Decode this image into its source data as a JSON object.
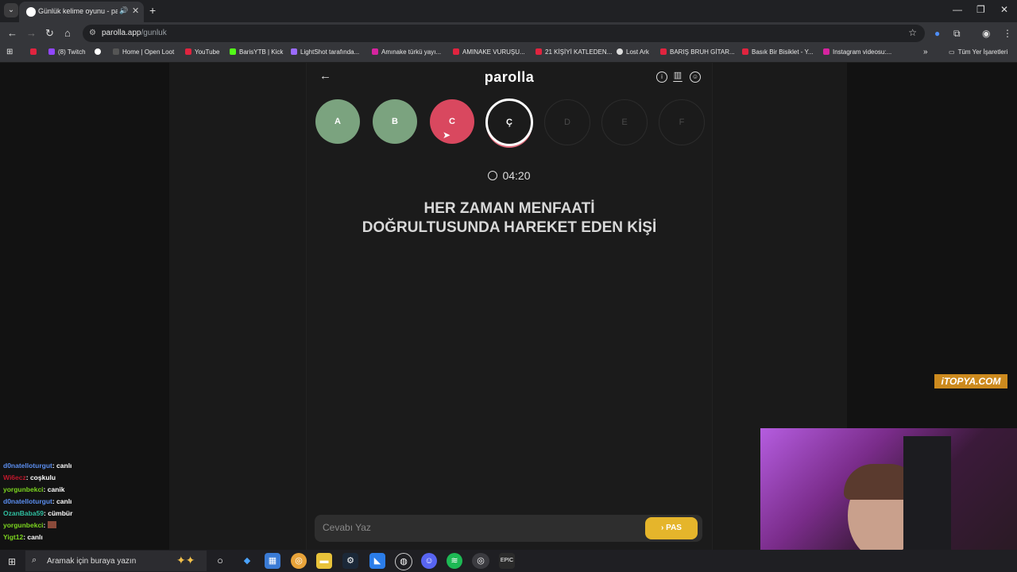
{
  "browser": {
    "tab_title": "Günlük kelime oyunu - parolla",
    "tab_audio_icon": "speaker-icon",
    "url_host": "parolla.app",
    "url_path": "/gunluk",
    "bookmarks": [
      {
        "label": "",
        "color": "#e0243f"
      },
      {
        "label": "(8) Twitch",
        "color": "#9146ff"
      },
      {
        "label": "",
        "color": "#ffffff"
      },
      {
        "label": "Home | Open Loot",
        "color": "#555555"
      },
      {
        "label": "YouTube",
        "color": "#e0243f"
      },
      {
        "label": "BarisYTB | Kick",
        "color": "#53fc18"
      },
      {
        "label": "LightShot tarafında...",
        "color": "#9b6bff"
      },
      {
        "label": "Amınake türkü yayı...",
        "color": "#d6249f"
      },
      {
        "label": "AMINAKE VURUŞU...",
        "color": "#e0243f"
      },
      {
        "label": "21 KİŞİYİ KATLEDEN...",
        "color": "#e0243f"
      },
      {
        "label": "Lost Ark",
        "color": "#dddddd"
      },
      {
        "label": "BARIŞ BRUH GİTAR...",
        "color": "#e0243f"
      },
      {
        "label": "Basık Bir Bisiklet - Y...",
        "color": "#e0243f"
      },
      {
        "label": "Instagram videosu:...",
        "color": "#d6249f"
      }
    ],
    "all_bookmarks_label": "Tüm Yer İşaretleri"
  },
  "app": {
    "logo": "parolla",
    "letters": [
      {
        "letter": "A",
        "state": "correct"
      },
      {
        "letter": "B",
        "state": "correct"
      },
      {
        "letter": "C",
        "state": "wrong"
      },
      {
        "letter": "Ç",
        "state": "active"
      },
      {
        "letter": "D",
        "state": "pending"
      },
      {
        "letter": "E",
        "state": "pending"
      },
      {
        "letter": "F",
        "state": "pending"
      }
    ],
    "timer": "04:20",
    "question_line1": "HER ZAMAN MENFAATİ",
    "question_line2": "DOĞRULTUSUNDA HAREKET EDEN KİŞİ",
    "answer_placeholder": "Cevabı Yaz",
    "pass_label": "PAS",
    "colors": {
      "correct": "#7ba37f",
      "wrong": "#d9485f",
      "pass": "#e5b52b"
    }
  },
  "overlay": {
    "watermark": "iTOPYA.COM"
  },
  "chat": [
    {
      "user": "d0natelloturgut",
      "msg": ": canlı",
      "color": "#5b8ef0"
    },
    {
      "user": "Wi6ecz",
      "msg": ": coşkulu",
      "color": "#c0182c"
    },
    {
      "user": "yorgunbekci",
      "msg": ": canik",
      "color": "#7cd61f"
    },
    {
      "user": "d0natelloturgut",
      "msg": ": canlı",
      "color": "#5b8ef0"
    },
    {
      "user": "OzanBaba59",
      "msg": ": cümbür",
      "color": "#2fbfa0"
    },
    {
      "user": "yorgunbekci",
      "msg": ":",
      "color": "#7cd61f"
    },
    {
      "user": "Yigt12",
      "msg": ": canlı",
      "color": "#7cd61f"
    }
  ],
  "taskbar": {
    "search_placeholder": "Aramak için buraya yazın"
  }
}
